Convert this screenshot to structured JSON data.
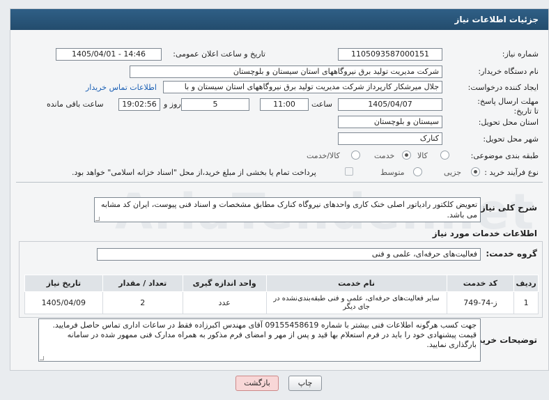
{
  "panel": {
    "title": "جزئیات اطلاعات نیاز"
  },
  "fields": {
    "need_number_label": "شماره نیاز:",
    "need_number": "1105093587000151",
    "announce_label": "تاریخ و ساعت اعلان عمومی:",
    "announce_value": "1405/04/01 - 14:46",
    "buyer_label": "نام دستگاه خریدار:",
    "buyer_value": "شرکت مدیریت تولید برق نیروگاههای استان سیستان و بلوچستان",
    "creator_label": "ایجاد کننده درخواست:",
    "creator_value": "جلال میرشکار کارپرداز شرکت مدیریت تولید برق نیروگاههای استان سیستان و با",
    "contact_link": "اطلاعات تماس خریدار",
    "deadline_label": "مهلت ارسال پاسخ: تا تاریخ:",
    "deadline_date": "1405/04/07",
    "time_label": "ساعت",
    "deadline_time": "11:00",
    "days_value": "5",
    "days_label": "روز و",
    "remaining_time": "19:02:56",
    "remaining_label": "ساعت باقی مانده",
    "province_label": "استان محل تحویل:",
    "province_value": "سیستان و بلوچستان",
    "city_label": "شهر محل تحویل:",
    "city_value": "کنارک",
    "category_label": "طبقه بندی موضوعی:",
    "category_options": [
      "کالا",
      "خدمت",
      "کالا/خدمت"
    ],
    "category_selected": "خدمت",
    "process_label": "نوع فرآیند خرید :",
    "process_options": [
      "جزیی",
      "متوسط"
    ],
    "process_selected": "جزیی",
    "payment_note": "پرداخت تمام یا بخشی از مبلغ خرید،از محل \"اسناد خزانه اسلامی\" خواهد بود."
  },
  "summary": {
    "label": "شرح کلی نیاز:",
    "text": "تعویض کلکتور رادیاتور اصلی خنک کاری واحدهای نیروگاه کنارک مطابق مشخصات و اسناد فنی پیوست، ایران کد مشابه می باشد."
  },
  "services": {
    "heading": "اطلاعات خدمات مورد نیاز",
    "group_label": "گروه خدمت:",
    "group_value": "فعالیت‌های حرفه‌ای، علمی و فنی",
    "columns": [
      "ردیف",
      "کد خدمت",
      "نام خدمت",
      "واحد اندازه گیری",
      "تعداد / مقدار",
      "تاریخ نیاز"
    ],
    "rows": [
      {
        "row": "1",
        "code": "ز-74-749",
        "name": "سایر فعالیت‌های حرفه‌ای، علمی و فنی طبقه‌بندی‌نشده در جای دیگر",
        "unit": "عدد",
        "qty": "2",
        "date": "1405/04/09"
      }
    ]
  },
  "buyer_notes": {
    "label": "توضیحات خریدار:",
    "text": "جهت کسب هرگونه اطلاعات فنی بیشتر با شماره 09155458619 آقای مهندس اکبرزاده فقط در ساعات اداری تماس حاصل فرمایید. قیمت پیشنهادی خود را باید در فرم استعلام بها قید و پس از مهر و امضای فرم مذکور به همراه مدارک فنی ممهور شده در سامانه بارگذاری نمایید."
  },
  "buttons": {
    "print": "چاپ",
    "back": "بازگشت"
  },
  "watermark": "AriaTender.net",
  "colors": {
    "titlebar": "#2f5f86",
    "link": "#1a5fb4",
    "back_button": "#f8d7d7"
  }
}
